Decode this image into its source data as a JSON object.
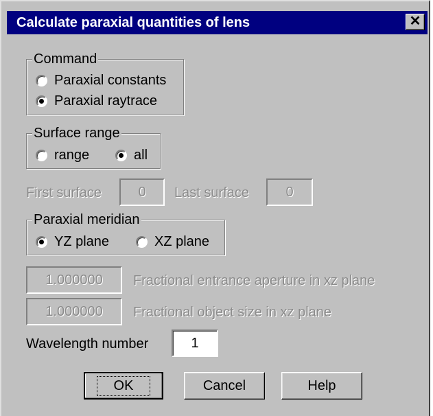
{
  "dialog": {
    "title": "Calculate paraxial quantities of lens",
    "close_glyph": "✕"
  },
  "command": {
    "legend": "Command",
    "options": [
      {
        "label": "Paraxial constants",
        "checked": false
      },
      {
        "label": "Paraxial raytrace",
        "checked": true
      }
    ]
  },
  "surface_range": {
    "legend": "Surface range",
    "options": [
      {
        "label": "range",
        "checked": false
      },
      {
        "label": "all",
        "checked": true
      }
    ]
  },
  "surfaces": {
    "first_label": "First surface",
    "first_value": "0",
    "last_label": "Last surface",
    "last_value": "0"
  },
  "meridian": {
    "legend": "Paraxial meridian",
    "options": [
      {
        "label": "YZ plane",
        "checked": true
      },
      {
        "label": "XZ plane",
        "checked": false
      }
    ]
  },
  "aperture": {
    "value": "1.000000",
    "label": "Fractional entrance aperture in xz plane"
  },
  "object_size": {
    "value": "1.000000",
    "label": "Fractional object size in xz plane"
  },
  "wavelength": {
    "label": "Wavelength number",
    "value": "1"
  },
  "buttons": {
    "ok": "OK",
    "cancel": "Cancel",
    "help": "Help"
  }
}
